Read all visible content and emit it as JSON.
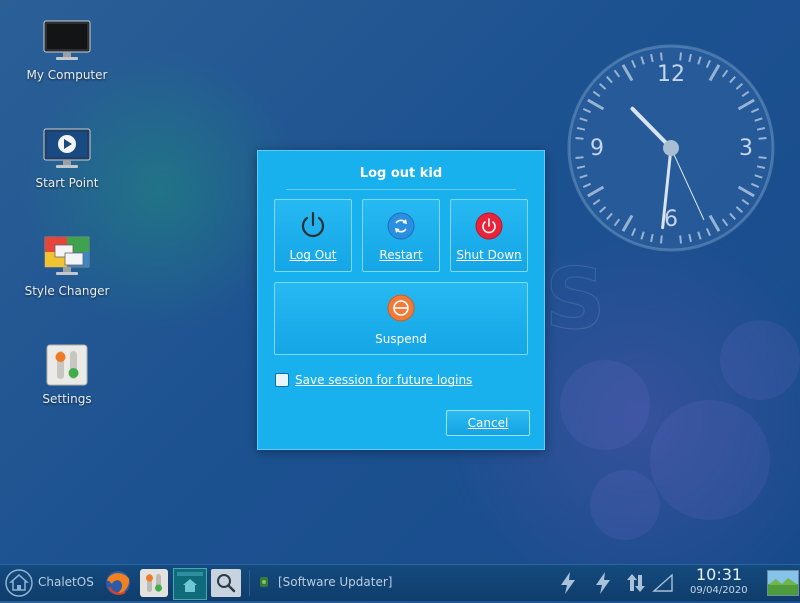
{
  "desktop": {
    "icons": [
      {
        "label": "My Computer",
        "icon": "monitor-icon"
      },
      {
        "label": "Start Point",
        "icon": "play-monitor-icon"
      },
      {
        "label": "Style Changer",
        "icon": "style-changer-icon"
      },
      {
        "label": "Settings",
        "icon": "settings-toggles-icon"
      }
    ],
    "watermark": "S",
    "clock_widget": {
      "hour": 10,
      "minute": 31,
      "numerals": [
        "12",
        "3",
        "6",
        "9"
      ]
    }
  },
  "dialog": {
    "title": "Log out kid",
    "options": [
      {
        "label": "Log Out",
        "icon": "power-icon",
        "color": "#2b2f33"
      },
      {
        "label": "Restart",
        "icon": "restart-icon",
        "color": "#2a8fe0"
      },
      {
        "label": "Shut Down",
        "icon": "shutdown-icon",
        "color": "#e8233a"
      },
      {
        "label": "Suspend",
        "icon": "suspend-icon",
        "color": "#f07a3a"
      }
    ],
    "save_session_label": "Save session for future logins",
    "save_session_checked": false,
    "cancel_label": "Cancel"
  },
  "taskbar": {
    "menu_label": "ChaletOS",
    "launchers": [
      "firefox-icon",
      "settings-toggles-icon",
      "file-manager-icon",
      "search-icon"
    ],
    "task_label": "[Software Updater]",
    "tray": [
      "power-bolt-icon",
      "power-bolt-icon",
      "network-arrows-icon",
      "signal-icon"
    ],
    "time": "10:31",
    "date": "09/04/2020"
  },
  "colors": {
    "dialog_bg": "#19b0ee",
    "desktop_bg": "#1d5291",
    "taskbar_bg": "#0f3d6b"
  }
}
